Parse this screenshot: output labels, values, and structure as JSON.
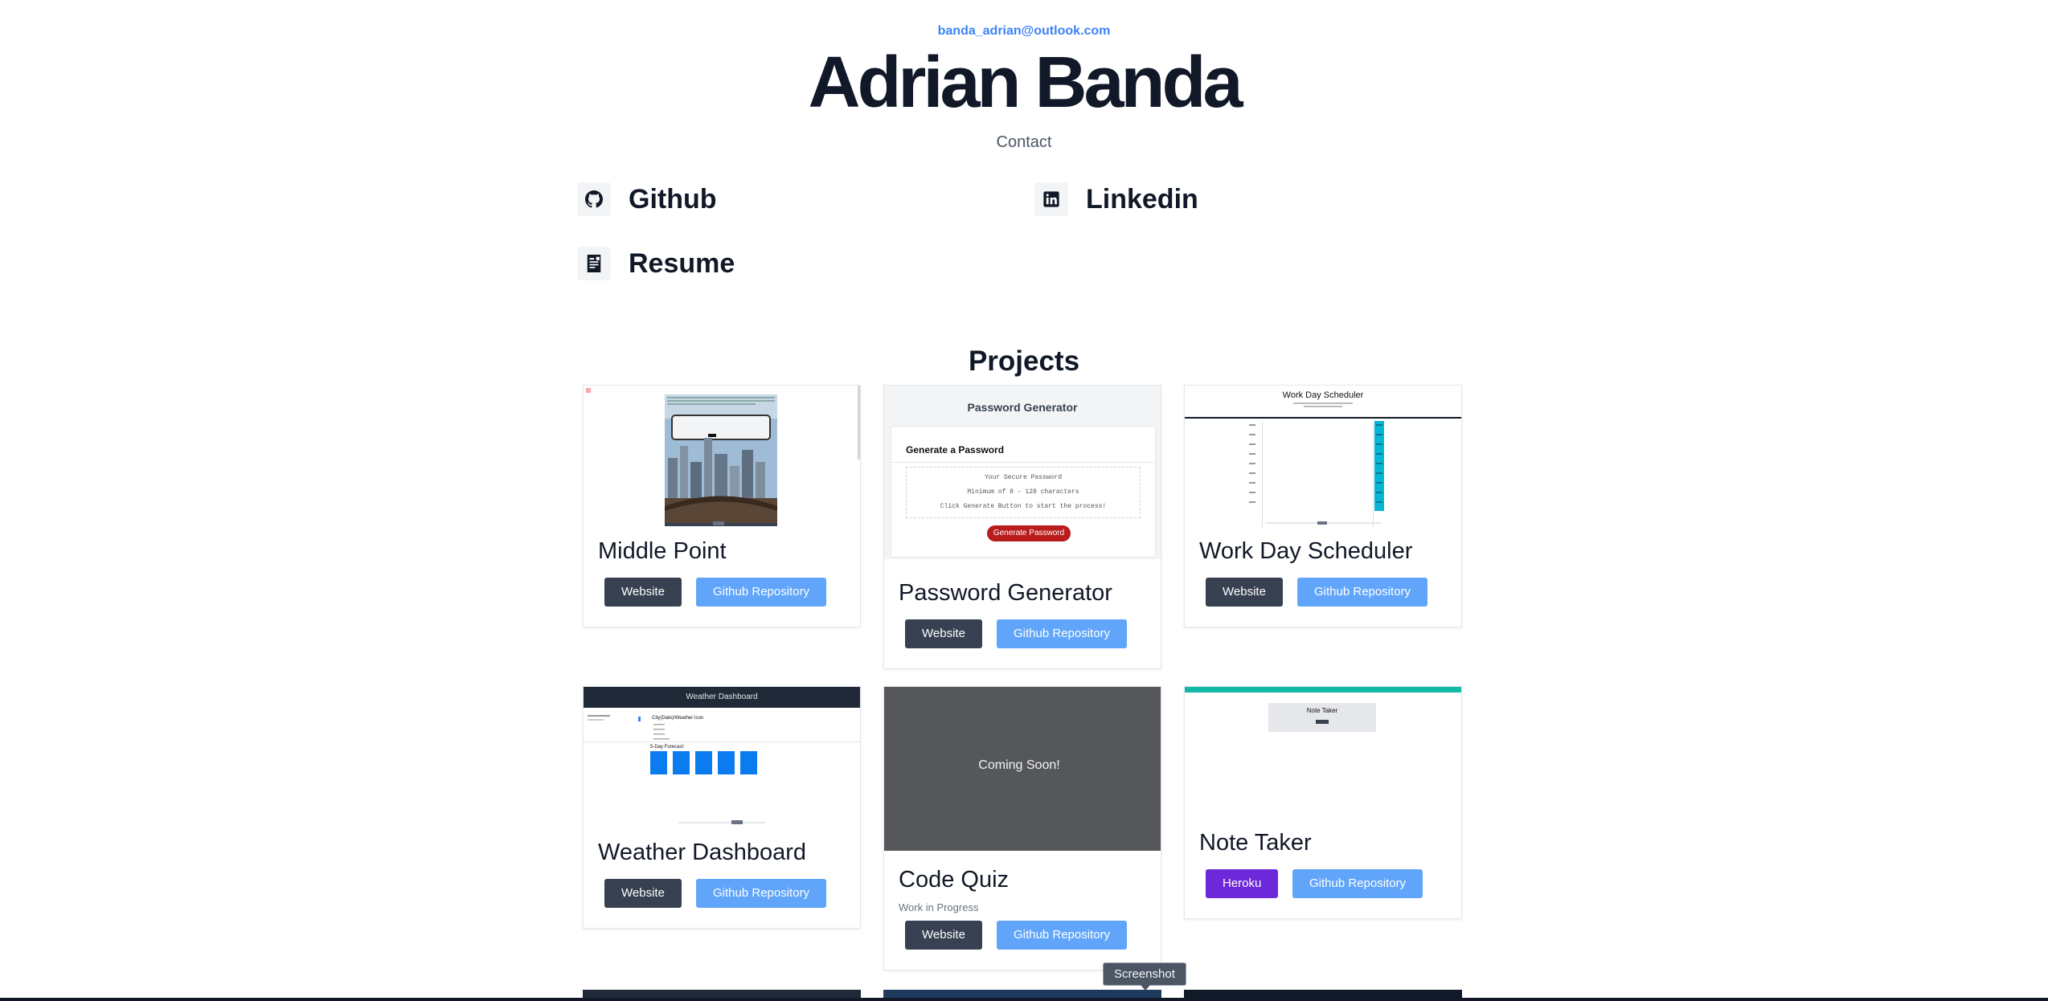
{
  "header": {
    "email": "banda_adrian@outlook.com",
    "name": "Adrian Banda",
    "contact_label": "Contact"
  },
  "links": [
    {
      "label": "Github",
      "icon": "github-icon"
    },
    {
      "label": "Linkedin",
      "icon": "linkedin-icon"
    },
    {
      "label": "Resume",
      "icon": "resume-icon"
    }
  ],
  "projects": {
    "title": "Projects",
    "cards": [
      {
        "title": "Middle Point",
        "buttons": [
          "Website",
          "Github Repository"
        ]
      },
      {
        "title": "Password Generator",
        "buttons": [
          "Website",
          "Github Repository"
        ],
        "preview": {
          "header": "Password Generator",
          "subheader": "Generate a Password",
          "lines": [
            "Your Secure Password",
            "Minimum of 8 - 128 characters",
            "Click Generate Button to start the process!"
          ],
          "button": "Generate Password"
        }
      },
      {
        "title": "Work Day Scheduler",
        "buttons": [
          "Website",
          "Github Repository"
        ],
        "preview": {
          "header": "Work Day Scheduler"
        }
      },
      {
        "title": "Weather Dashboard",
        "buttons": [
          "Website",
          "Github Repository"
        ],
        "preview": {
          "header": "Weather Dashboard",
          "city": "City(Date)/Weather Icon",
          "forecast": "5-Day Forecast:"
        }
      },
      {
        "title": "Code Quiz",
        "note": "Work in Progress",
        "buttons": [
          "Website",
          "Github Repository"
        ],
        "preview": {
          "placeholder": "Coming Soon!"
        }
      },
      {
        "title": "Note Taker",
        "buttons": [
          "Heroku",
          "Github Repository"
        ],
        "preview": {
          "header": "Note Taker"
        }
      }
    ]
  },
  "tooltip": "Screenshot",
  "colors": {
    "accent": "#3b82f6",
    "dark_button": "#374151",
    "blue_button": "#60a5fa",
    "purple_button": "#6d28d9"
  }
}
